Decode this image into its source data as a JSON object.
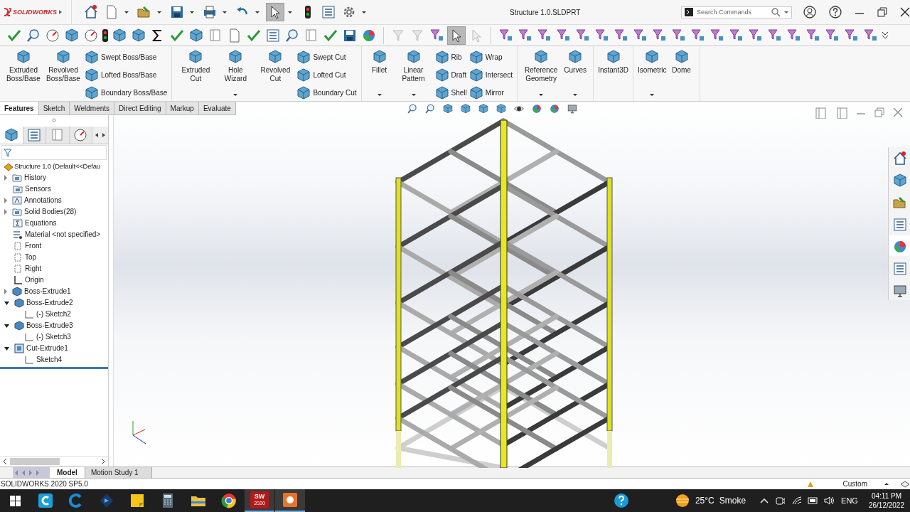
{
  "title_bar": {
    "logo": "SOLIDWORKS",
    "title": "Structure 1.0.SLDPRT",
    "search": {
      "placeholder": "Search Commands"
    }
  },
  "command_manager": {
    "groups": [
      {
        "items": [
          {
            "kind": "large",
            "label": "Extruded Boss/Base",
            "dropdown": false
          },
          {
            "kind": "large",
            "label": "Revolved Boss/Base",
            "dropdown": false
          },
          {
            "kind": "stack",
            "items": [
              {
                "label": "Swept Boss/Base"
              },
              {
                "label": "Lofted Boss/Base"
              },
              {
                "label": "Boundary Boss/Base"
              }
            ]
          }
        ]
      },
      {
        "items": [
          {
            "kind": "large",
            "label": "Extruded Cut",
            "dropdown": false
          },
          {
            "kind": "large",
            "label": "Hole Wizard",
            "dropdown": true
          },
          {
            "kind": "large",
            "label": "Revolved Cut",
            "dropdown": false
          },
          {
            "kind": "stack",
            "items": [
              {
                "label": "Swept Cut"
              },
              {
                "label": "Lofted Cut"
              },
              {
                "label": "Boundary Cut"
              }
            ]
          }
        ]
      },
      {
        "items": [
          {
            "kind": "large",
            "label": "Fillet",
            "dropdown": true
          },
          {
            "kind": "large",
            "label": "Linear Pattern",
            "dropdown": true
          },
          {
            "kind": "stack",
            "items": [
              {
                "label": "Rib"
              },
              {
                "label": "Draft"
              },
              {
                "label": "Shell"
              }
            ]
          },
          {
            "kind": "stack",
            "items": [
              {
                "label": "Wrap"
              },
              {
                "label": "Intersect"
              },
              {
                "label": "Mirror"
              }
            ]
          }
        ]
      },
      {
        "items": [
          {
            "kind": "large",
            "label": "Reference Geometry",
            "dropdown": true
          },
          {
            "kind": "large",
            "label": "Curves",
            "dropdown": true
          }
        ]
      },
      {
        "items": [
          {
            "kind": "large",
            "label": "Instant3D",
            "dropdown": false
          }
        ]
      },
      {
        "items": [
          {
            "kind": "large",
            "label": "Isometric",
            "dropdown": true
          },
          {
            "kind": "large",
            "label": "Dome",
            "dropdown": false
          }
        ]
      }
    ]
  },
  "tabs": [
    {
      "label": "Features",
      "selected": true
    },
    {
      "label": "Sketch",
      "selected": false
    },
    {
      "label": "Weldments",
      "selected": false
    },
    {
      "label": "Direct Editing",
      "selected": false
    },
    {
      "label": "Markup",
      "selected": false
    },
    {
      "label": "Evaluate",
      "selected": false
    }
  ],
  "feature_tree": {
    "root": "Structure 1.0  (Default<<Defau",
    "items": [
      {
        "kind": "folder",
        "label": "History",
        "expandable": true,
        "expanded": false
      },
      {
        "kind": "folder",
        "label": "Sensors",
        "expandable": false
      },
      {
        "kind": "annotation",
        "label": "Annotations",
        "expandable": true,
        "expanded": false
      },
      {
        "kind": "folder",
        "label": "Solid Bodies(28)",
        "expandable": true,
        "expanded": false
      },
      {
        "kind": "equation",
        "label": "Equations",
        "expandable": false
      },
      {
        "kind": "material",
        "label": "Material <not specified>",
        "expandable": false
      },
      {
        "kind": "plane",
        "label": "Front",
        "expandable": false
      },
      {
        "kind": "plane",
        "label": "Top",
        "expandable": false
      },
      {
        "kind": "plane",
        "label": "Right",
        "expandable": false
      },
      {
        "kind": "origin",
        "label": "Origin",
        "expandable": false
      },
      {
        "kind": "extrude",
        "label": "Boss-Extrude1",
        "expandable": true,
        "expanded": false
      },
      {
        "kind": "extrude",
        "label": "Boss-Extrude2",
        "expandable": true,
        "expanded": true,
        "children": [
          {
            "kind": "sketch",
            "label": "(-) Sketch2",
            "expandable": false
          }
        ]
      },
      {
        "kind": "extrude",
        "label": "Boss-Extrude3",
        "expandable": true,
        "expanded": true,
        "children": [
          {
            "kind": "sketch",
            "label": "(-) Sketch3",
            "expandable": false
          }
        ]
      },
      {
        "kind": "cut",
        "label": "Cut-Extrude1",
        "expandable": true,
        "expanded": true,
        "children": [
          {
            "kind": "sketch",
            "label": "Sketch4",
            "expandable": false
          }
        ]
      }
    ]
  },
  "bottom_tabs": [
    {
      "label": "Model",
      "selected": true
    },
    {
      "label": "Motion Study 1",
      "selected": false
    }
  ],
  "status_bar": {
    "version": "SOLIDWORKS 2020 SP5.0",
    "units": "Custom"
  },
  "taskbar": {
    "apps": [
      {
        "kind": "c-cyan",
        "running": false
      },
      {
        "kind": "c-blue",
        "running": false
      },
      {
        "kind": "arrow",
        "running": false
      },
      {
        "kind": "note",
        "running": false
      },
      {
        "kind": "calculator",
        "running": false
      },
      {
        "kind": "folder",
        "running": false
      },
      {
        "kind": "browser",
        "running": false
      },
      {
        "kind": "sw",
        "label": "SW",
        "sublabel": "2020",
        "running": true
      },
      {
        "kind": "recorder",
        "running": true
      }
    ],
    "temperature": "25°C",
    "weather": "Smoke",
    "language": "ENG",
    "time": "04:11 PM",
    "date": "26/12/2022"
  }
}
